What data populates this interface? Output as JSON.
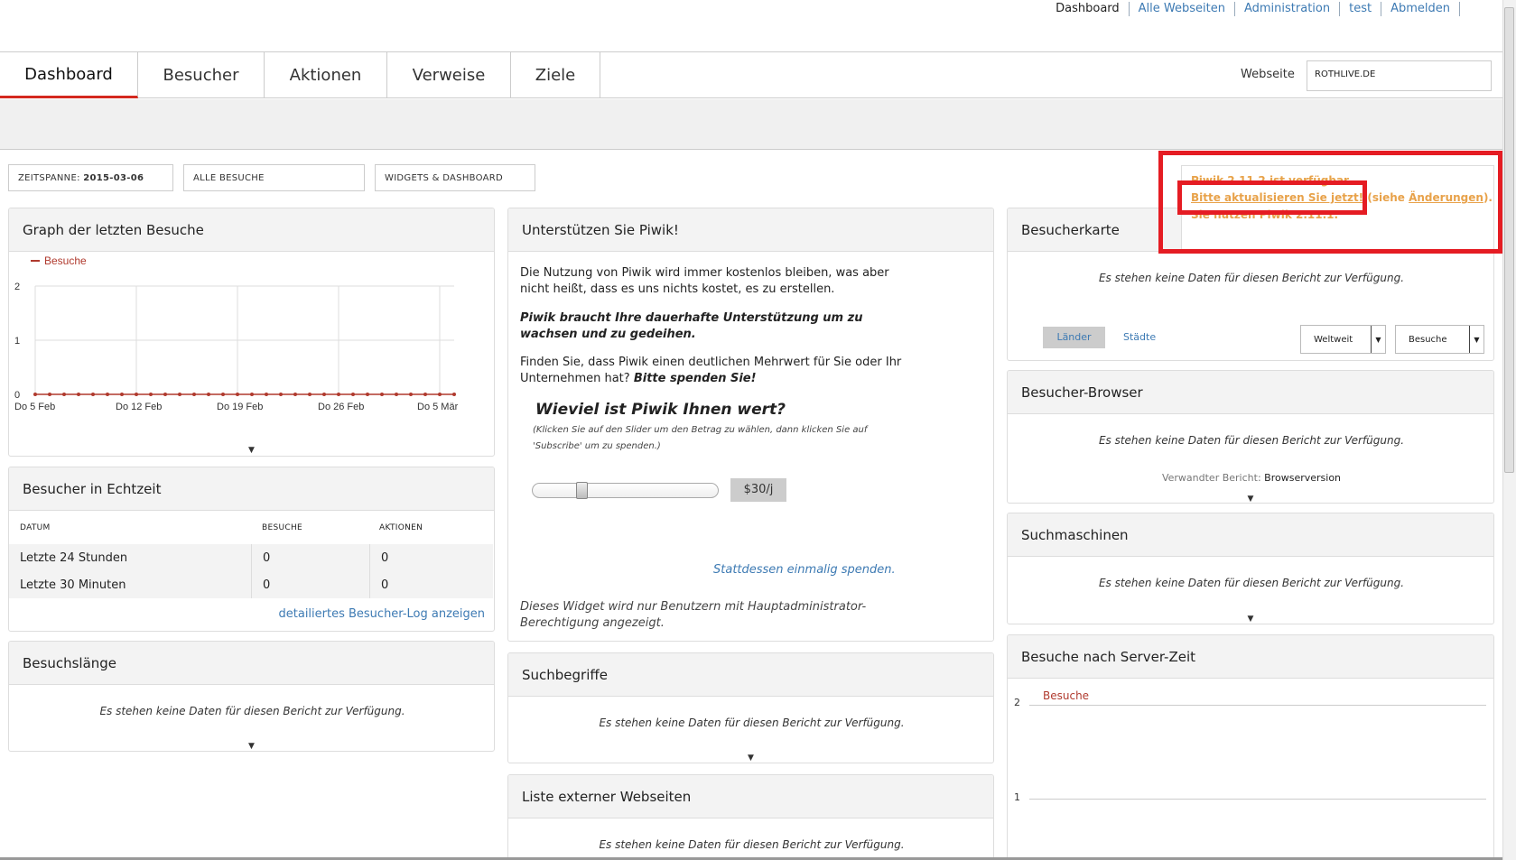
{
  "top_links": [
    "Dashboard",
    "Alle Webseiten",
    "Administration",
    "test",
    "Abmelden"
  ],
  "nav": {
    "tabs": [
      "Dashboard",
      "Besucher",
      "Aktionen",
      "Verweise",
      "Ziele"
    ],
    "site_label": "Webseite",
    "site_value": "ROTHLIVE.DE"
  },
  "controls": {
    "period_label": "ZEITSPANNE:",
    "period_value": "2015-03-06",
    "segment": "ALLE BESUCHE",
    "widgets": "WIDGETS & DASHBOARD"
  },
  "notification": {
    "line1": "Piwik 2.11.2 ist verfügbar.",
    "update_link": "Bitte aktualisieren Sie jetzt!",
    "see": "(siehe",
    "changes": "Änderungen",
    "line3": "Sie nutzen Piwik 2.11.1."
  },
  "no_data": "Es stehen keine Daten für diesen Bericht zur Verfügung.",
  "graph": {
    "title": "Graph der letzten Besuche",
    "legend": "Besuche"
  },
  "chart_data": {
    "type": "line",
    "series": [
      {
        "name": "Besuche",
        "values": [
          0,
          0,
          0,
          0,
          0,
          0,
          0,
          0,
          0,
          0,
          0,
          0,
          0,
          0,
          0,
          0,
          0,
          0,
          0,
          0,
          0,
          0,
          0,
          0,
          0,
          0,
          0,
          0,
          0,
          0
        ]
      }
    ],
    "x_tick_labels": [
      "Do 5 Feb",
      "Do 12 Feb",
      "Do 19 Feb",
      "Do 26 Feb",
      "Do 5 Mär"
    ],
    "y_tick_labels": [
      "0",
      "1",
      "2"
    ],
    "ylim": [
      0,
      2
    ],
    "grid": true,
    "legend": "top-left"
  },
  "realtime": {
    "title": "Besucher in Echtzeit",
    "columns": [
      "DATUM",
      "BESUCHE",
      "AKTIONEN"
    ],
    "rows": [
      [
        "Letzte 24 Stunden",
        "0",
        "0"
      ],
      [
        "Letzte 30 Minuten",
        "0",
        "0"
      ]
    ],
    "link": "detailiertes Besucher-Log anzeigen"
  },
  "duration": {
    "title": "Besuchslänge"
  },
  "support": {
    "title": "Unterstützen Sie Piwik!",
    "p1": "Die Nutzung von Piwik wird immer kostenlos bleiben, was aber nicht heißt, dass es uns nichts kostet, es zu erstellen.",
    "p2": "Piwik braucht Ihre dauerhafte Unterstützung um zu wachsen und zu gedeihen.",
    "p3a": "Finden Sie, dass Piwik einen deutlichen Mehrwert für Sie oder Ihr Unternehmen hat?",
    "p3b": "Bitte spenden Sie!",
    "heading": "Wieviel ist Piwik Ihnen wert?",
    "hint": "(Klicken Sie auf den Slider um den Betrag zu wählen, dann klicken Sie auf 'Subscribe' um zu spenden.)",
    "slider_value": 0.25,
    "amount": "$30/j",
    "once": "Stattdessen einmalig spenden.",
    "footer": "Dieses Widget wird nur Benutzern mit Hauptadministrator-Berechtigung angezeigt."
  },
  "keywords": {
    "title": "Suchbegriffe"
  },
  "external": {
    "title": "Liste externer Webseiten"
  },
  "map": {
    "title": "Besucherkarte",
    "tab_countries": "Länder",
    "tab_cities": "Städte",
    "region": "Weltweit",
    "metric": "Besuche"
  },
  "browser": {
    "title": "Besucher-Browser",
    "related_label": "Verwandter Bericht:",
    "related_value": "Browserversion"
  },
  "search_engines": {
    "title": "Suchmaschinen"
  },
  "server_time": {
    "title": "Besuche nach Server-Zeit",
    "legend": "Besuche",
    "y2": "2",
    "y1": "1"
  },
  "colors": {
    "accent": "#d4291f",
    "link": "#3d7ab3",
    "series": "#b03a2e",
    "notification": "#e8a24a",
    "highlight": "#e51c23"
  }
}
